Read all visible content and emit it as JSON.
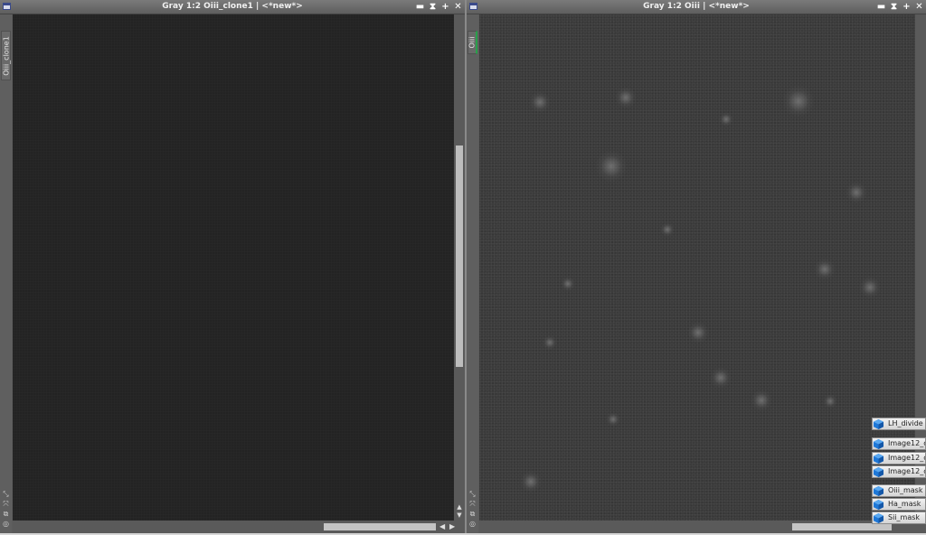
{
  "left_window": {
    "title": "Gray 1:2 Oiii_clone1 | <*new*>",
    "vertical_tab": "Oiii_clone1",
    "buttons": [
      "minimize",
      "shade",
      "maximize",
      "close"
    ]
  },
  "right_window": {
    "title": "Gray 1:2 Oiii | <*new*>",
    "vertical_tab": "Oiii",
    "buttons": [
      "minimize",
      "shade",
      "maximize",
      "close"
    ]
  },
  "button_glyphs": {
    "minimize": "▬",
    "shade": "⧗",
    "maximize": "+",
    "close": "✕"
  },
  "image_icons": [
    {
      "label": "LH_divide"
    },
    {
      "label": "Image12_c"
    },
    {
      "label": "Image12_c"
    },
    {
      "label": "Image12_c"
    },
    {
      "label": "Oiii_mask"
    },
    {
      "label": "Ha_mask"
    },
    {
      "label": "Sii_mask"
    }
  ],
  "colors": {
    "cube": "#1e78d8",
    "accent_tab": "#29a04a"
  }
}
